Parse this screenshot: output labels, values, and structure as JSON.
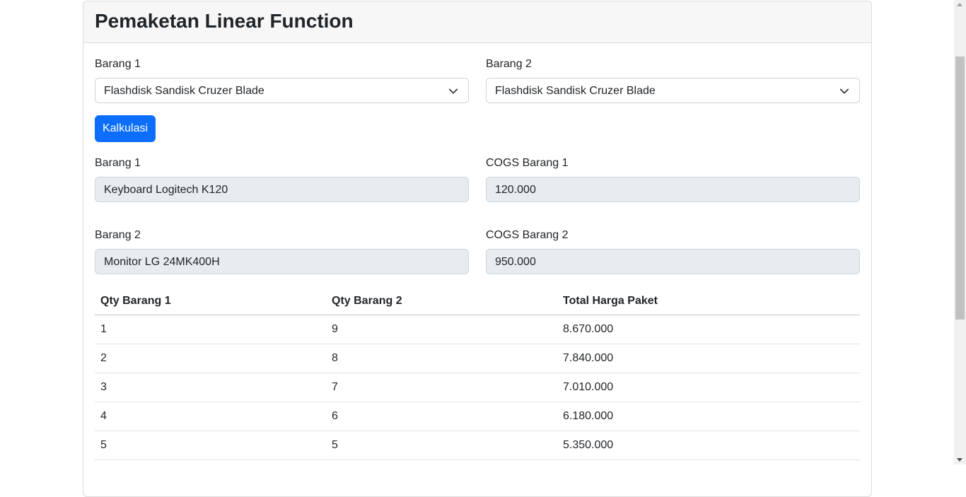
{
  "page": {
    "title": "Pemaketan Linear Function"
  },
  "form": {
    "select1": {
      "label": "Barang 1",
      "value": "Flashdisk Sandisk Cruzer Blade"
    },
    "select2": {
      "label": "Barang 2",
      "value": "Flashdisk Sandisk Cruzer Blade"
    },
    "button_label": "Kalkulasi"
  },
  "result": {
    "item1": {
      "label": "Barang 1",
      "value": "Keyboard Logitech K120"
    },
    "cogs1": {
      "label": "COGS Barang 1",
      "value": "120.000"
    },
    "item2": {
      "label": "Barang 2",
      "value": "Monitor LG 24MK400H"
    },
    "cogs2": {
      "label": "COGS Barang 2",
      "value": "950.000"
    }
  },
  "table": {
    "headers": [
      "Qty Barang 1",
      "Qty Barang 2",
      "Total Harga Paket"
    ],
    "rows": [
      [
        "1",
        "9",
        "8.670.000"
      ],
      [
        "2",
        "8",
        "7.840.000"
      ],
      [
        "3",
        "7",
        "7.010.000"
      ],
      [
        "4",
        "6",
        "6.180.000"
      ],
      [
        "5",
        "5",
        "5.350.000"
      ]
    ]
  },
  "icons": {
    "select_chevron": "chevron-down-icon"
  },
  "colors": {
    "primary": "#0d6efd",
    "readonly_bg": "#e9ecef",
    "header_bg": "#f7f7f7"
  }
}
